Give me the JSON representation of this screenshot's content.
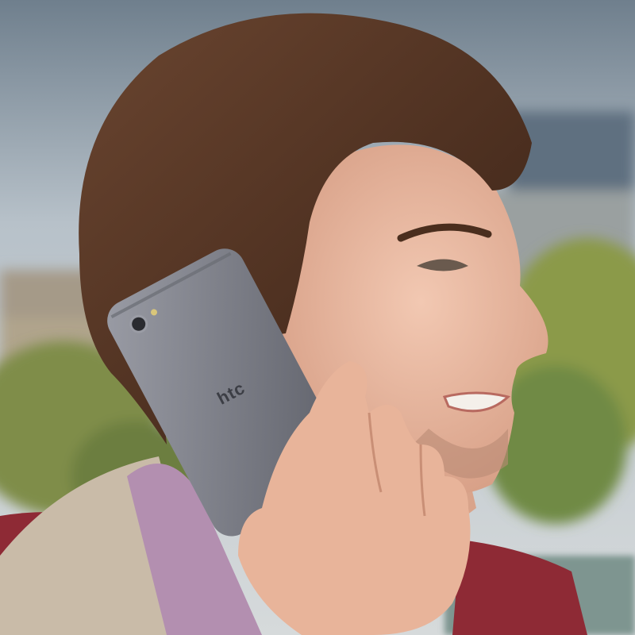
{
  "photo": {
    "phone_logo": "htc",
    "colors": {
      "sky": "#b9c3cb",
      "hair": "#4a2e1e",
      "skin": "#e9b8a0",
      "phone": "#7d7f88",
      "jacket": "#8e2a35",
      "scarf": "#b38fb0",
      "hood": "#c9bba8",
      "foliage": "#8a9a4e"
    }
  }
}
